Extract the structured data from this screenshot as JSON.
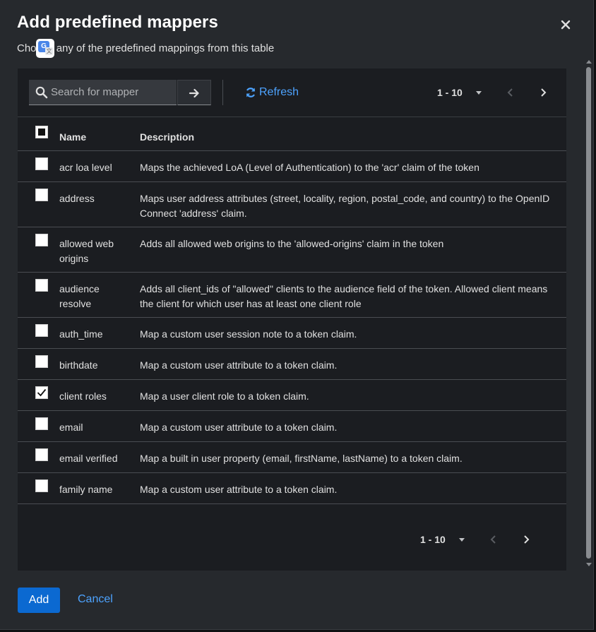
{
  "dialog": {
    "title": "Add predefined mappers",
    "description": "Choose any of the predefined mappings from this table",
    "description_visible_start": "Cho",
    "description_visible_rest": " any of the predefined mappings from this table"
  },
  "toolbar": {
    "search_placeholder": "Search for mapper",
    "refresh_label": "Refresh",
    "pagination_range": "1 - 10"
  },
  "table": {
    "columns": [
      "Name",
      "Description"
    ],
    "rows": [
      {
        "name": "acr loa level",
        "description": "Maps the achieved LoA (Level of Authentication) to the 'acr' claim of the token",
        "checked": false
      },
      {
        "name": "address",
        "description": "Maps user address attributes (street, locality, region, postal_code, and country) to the OpenID Connect 'address' claim.",
        "checked": false
      },
      {
        "name": "allowed web origins",
        "description": "Adds all allowed web origins to the 'allowed-origins' claim in the token",
        "checked": false
      },
      {
        "name": "audience resolve",
        "description": "Adds all client_ids of \"allowed\" clients to the audience field of the token. Allowed client means the client for which user has at least one client role",
        "checked": false
      },
      {
        "name": "auth_time",
        "description": "Map a custom user session note to a token claim.",
        "checked": false
      },
      {
        "name": "birthdate",
        "description": "Map a custom user attribute to a token claim.",
        "checked": false
      },
      {
        "name": "client roles",
        "description": "Map a user client role to a token claim.",
        "checked": true
      },
      {
        "name": "email",
        "description": "Map a custom user attribute to a token claim.",
        "checked": false
      },
      {
        "name": "email verified",
        "description": "Map a built in user property (email, firstName, lastName) to a token claim.",
        "checked": false
      },
      {
        "name": "family name",
        "description": "Map a custom user attribute to a token claim.",
        "checked": false
      }
    ]
  },
  "footer": {
    "pagination_range": "1 - 10",
    "add_label": "Add",
    "cancel_label": "Cancel"
  },
  "colors": {
    "modal_bg": "#26292d",
    "table_bg": "#1b1d21",
    "link_blue": "#4da3ff",
    "primary_blue": "#0b69d1"
  },
  "icons": [
    "close-icon",
    "search-icon",
    "arrow-right-icon",
    "refresh-icon",
    "caret-down-icon",
    "chevron-left-icon",
    "chevron-right-icon",
    "checkmark-icon",
    "translate-icon"
  ]
}
